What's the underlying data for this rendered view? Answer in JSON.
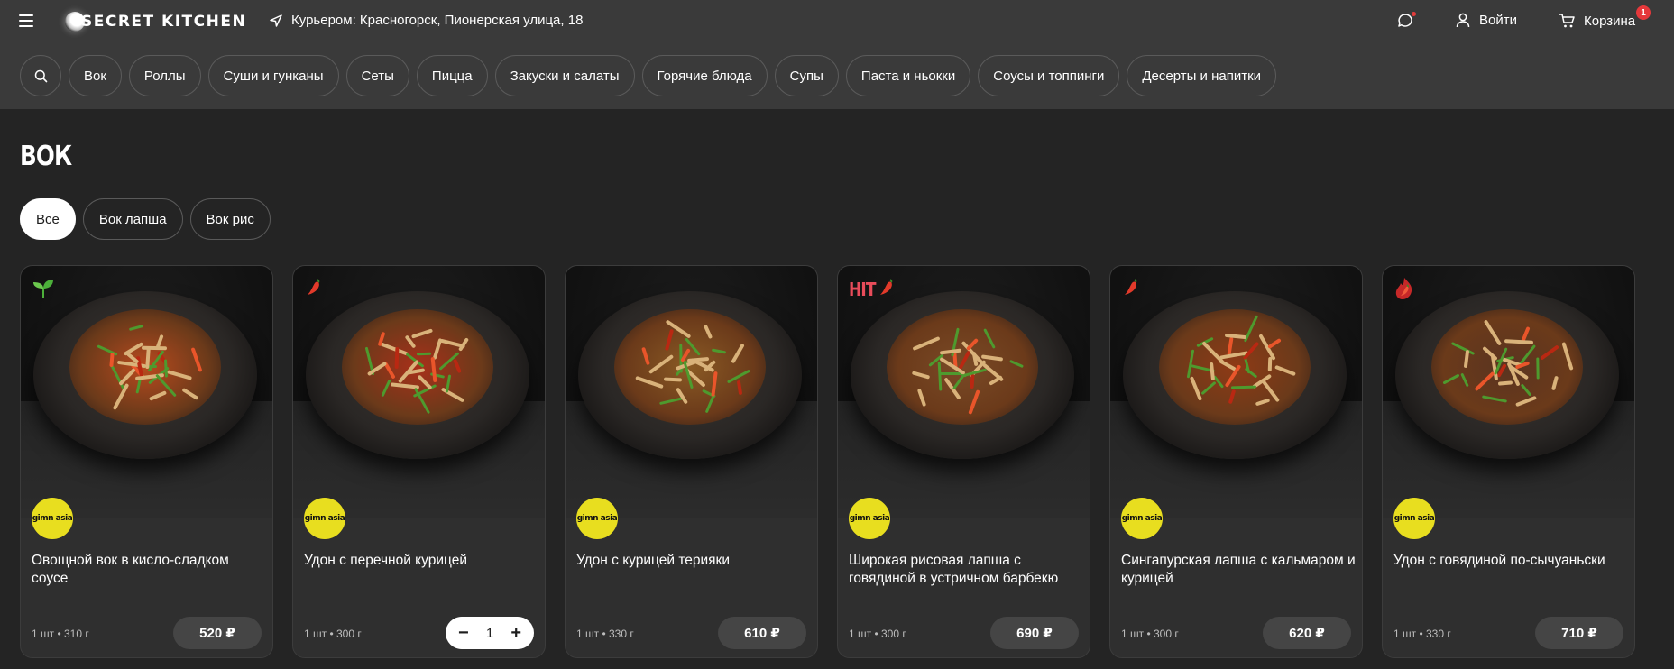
{
  "header": {
    "logo_text": "SECRET KITCHEN",
    "delivery_address": "Курьером: Красногорск, Пионерская улица, 18",
    "login_label": "Войти",
    "cart_label": "Корзина",
    "cart_count": "1"
  },
  "categories": [
    "Вок",
    "Роллы",
    "Суши и гунканы",
    "Сеты",
    "Пицца",
    "Закуски и салаты",
    "Горячие блюда",
    "Супы",
    "Паста и ньокки",
    "Соусы и топпинги",
    "Десерты и напитки"
  ],
  "page_title": "ВОК",
  "subcategories": [
    {
      "label": "Все",
      "active": true
    },
    {
      "label": "Вок лапша",
      "active": false
    },
    {
      "label": "Вок рис",
      "active": false
    }
  ],
  "brand_logo_text": "gimn asia",
  "products": [
    {
      "name": "Овощной вок в кисло-сладком соусе",
      "weight": "1 шт • 310 г",
      "price": "520 ₽",
      "badge": "leaf-icon",
      "hit": false,
      "in_cart": false,
      "qty": "",
      "sauce": "#b84a1e"
    },
    {
      "name": "Удон с перечной курицей",
      "weight": "1 шт • 300 г",
      "price": "",
      "badge": "chili-icon",
      "hit": false,
      "in_cart": true,
      "qty": "1",
      "sauce": "#a8301a"
    },
    {
      "name": "Удон с курицей терияки",
      "weight": "1 шт • 330 г",
      "price": "610 ₽",
      "badge": "",
      "hit": false,
      "in_cart": false,
      "qty": "",
      "sauce": "#8a5a24"
    },
    {
      "name": "Широкая рисовая лапша с говядиной в устричном барбекю",
      "weight": "1 шт • 300 г",
      "price": "690 ₽",
      "badge": "chili-icon",
      "hit": true,
      "hit_label": "HIT",
      "in_cart": false,
      "qty": "",
      "sauce": "#7a4a26"
    },
    {
      "name": "Сингапурская лапша с кальмаром и курицей",
      "weight": "1 шт • 300 г",
      "price": "620 ₽",
      "badge": "chili-icon",
      "hit": false,
      "in_cart": false,
      "qty": "",
      "sauce": "#8e3a16"
    },
    {
      "name": "Удон с говядиной по-сычуаньски",
      "weight": "1 шт • 330 г",
      "price": "710 ₽",
      "badge": "flame-chili-icon",
      "hit": false,
      "in_cart": false,
      "qty": "",
      "sauce": "#5a3420"
    }
  ],
  "colors": {
    "background": "#242424",
    "header": "#3a3a3a",
    "card": "#2f2f2f",
    "brand_yellow": "#e8de1f",
    "badge_red": "#e5383b",
    "hit_pink": "#e84c5a"
  }
}
